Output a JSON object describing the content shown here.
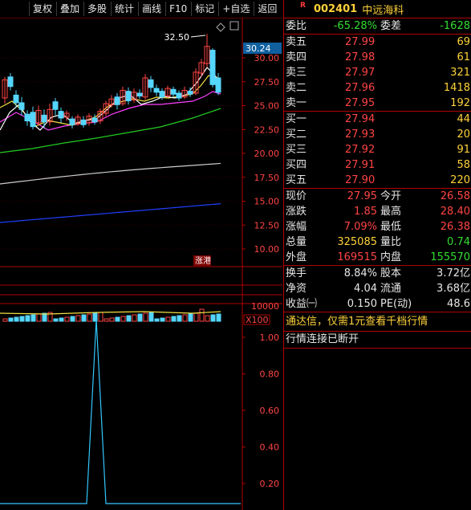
{
  "toolbar": {
    "buttons": [
      "复权",
      "叠加",
      "多股",
      "统计",
      "画线",
      "F10",
      "标记",
      "+自选",
      "返回"
    ]
  },
  "chart": {
    "price_axis": [
      "30.00",
      "27.50",
      "25.00",
      "22.50",
      "20.00",
      "17.50",
      "15.00",
      "12.50",
      "10.00"
    ],
    "current_price_tag": "30.24",
    "high_tip": "32.50",
    "badge": "涨港",
    "vol_axis": [
      "10000",
      "X100"
    ],
    "ind_axis": [
      "1.00",
      "0.80",
      "0.60",
      "0.40",
      "0.20"
    ]
  },
  "quote": {
    "r_mark": "R",
    "code": "002401",
    "name": "中远海科",
    "weibi_label": "委比",
    "weibi": "-65.28%",
    "weicha_label": "委差",
    "weicha": "-1628",
    "asks": [
      {
        "label": "卖五",
        "price": "27.99",
        "vol": "69"
      },
      {
        "label": "卖四",
        "price": "27.98",
        "vol": "61"
      },
      {
        "label": "卖三",
        "price": "27.97",
        "vol": "321"
      },
      {
        "label": "卖二",
        "price": "27.96",
        "vol": "1418"
      },
      {
        "label": "卖一",
        "price": "27.95",
        "vol": "192"
      }
    ],
    "bids": [
      {
        "label": "买一",
        "price": "27.94",
        "vol": "44"
      },
      {
        "label": "买二",
        "price": "27.93",
        "vol": "20"
      },
      {
        "label": "买三",
        "price": "27.92",
        "vol": "91"
      },
      {
        "label": "买四",
        "price": "27.91",
        "vol": "58"
      },
      {
        "label": "买五",
        "price": "27.90",
        "vol": "220"
      }
    ],
    "stats": [
      {
        "l1": "现价",
        "v1": "27.95",
        "l2": "今开",
        "v2": "26.58"
      },
      {
        "l1": "涨跌",
        "v1": "1.85",
        "l2": "最高",
        "v2": "28.40"
      },
      {
        "l1": "涨幅",
        "v1": "7.09%",
        "l2": "最低",
        "v2": "26.38"
      },
      {
        "l1": "总量",
        "v1": "325085",
        "l2": "量比",
        "v2": "0.74"
      },
      {
        "l1": "外盘",
        "v1": "169515",
        "l2": "内盘",
        "v2": "155570"
      }
    ],
    "extra": [
      {
        "l1": "换手",
        "v1": "8.84%",
        "l2": "股本",
        "v2": "3.72亿"
      },
      {
        "l1": "净资",
        "v1": "4.04",
        "l2": "流通",
        "v2": "3.68亿"
      },
      {
        "l1": "收益㈠",
        "v1": "0.150",
        "l2": "PE(动)",
        "v2": "48.6"
      }
    ],
    "notice": "通达信，仅需1元查看千档行情",
    "status": "行情连接已断开"
  },
  "colors": {
    "up": "#ff4444",
    "down": "#33dd33",
    "frame": "#b00000",
    "accent": "#ffd23a",
    "candle_down": "#54d6ff",
    "ma_white": "#ffffff",
    "ma_yellow": "#f0e040",
    "ma_magenta": "#ff40ff",
    "ma_green": "#22cc22",
    "ma_grey": "#cccccc",
    "ma_blue": "#2040ff"
  }
}
